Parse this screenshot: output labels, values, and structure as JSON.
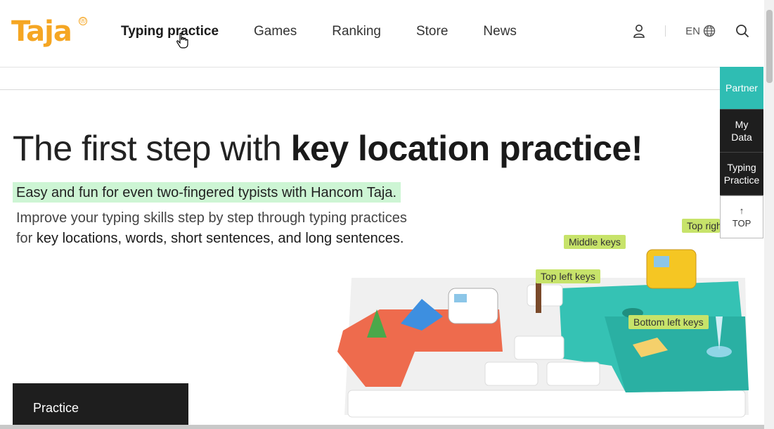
{
  "header": {
    "logo_text": "Taja",
    "logo_mark": "®",
    "nav": [
      {
        "label": "Typing practice",
        "active": true
      },
      {
        "label": "Games",
        "active": false
      },
      {
        "label": "Ranking",
        "active": false
      },
      {
        "label": "Store",
        "active": false
      },
      {
        "label": "News",
        "active": false
      }
    ],
    "lang": "EN",
    "icons": [
      "user-icon",
      "globe-icon",
      "search-icon"
    ]
  },
  "quick_menu": {
    "partner": "Partner",
    "my_data_1": "My",
    "my_data_2": "Data",
    "typing_1": "Typing",
    "typing_2": "Practice",
    "top_arrow": "↑",
    "top": "TOP"
  },
  "hero": {
    "title_light": "The first step with ",
    "title_bold": "key location practice!",
    "highlight": "Easy and fun for even two-fingered typists with Hancom Taja.",
    "desc_line1": "Improve your typing skills step by step through typing practices",
    "desc_line2_prefix": "for ",
    "desc_line2_bold": "key locations, words, short sentences, and long sentences."
  },
  "illustration": {
    "labels": {
      "middle": "Middle keys",
      "top_left": "Top left keys",
      "bottom_left": "Bottom left keys",
      "top_right": "Top right keys"
    }
  },
  "practice": {
    "label": "Practice"
  },
  "colors": {
    "accent": "#2fbdb3",
    "brand": "#f5a623",
    "highlight": "#cdf5d4",
    "key_label": "#c7e36a",
    "dark": "#1e1e1e"
  }
}
